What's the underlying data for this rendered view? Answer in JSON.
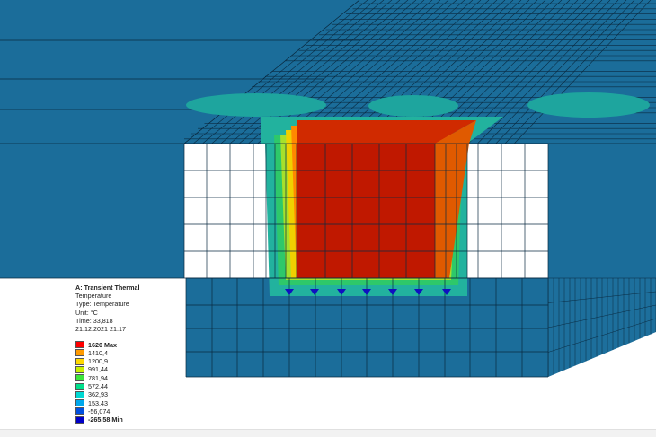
{
  "legend": {
    "title": "A: Transient Thermal",
    "lines": [
      "Temperature",
      "Type: Temperature",
      "Unit: °C",
      "Time: 33,818",
      "21.12.2021 21:17"
    ],
    "levels": [
      {
        "label": "1620 Max",
        "color": "#ff0000",
        "bold": true
      },
      {
        "label": "1410,4",
        "color": "#ff9a00",
        "bold": false
      },
      {
        "label": "1200,9",
        "color": "#ffd800",
        "bold": false
      },
      {
        "label": "991,44",
        "color": "#c8f000",
        "bold": false
      },
      {
        "label": "781,94",
        "color": "#3ce63c",
        "bold": false
      },
      {
        "label": "572,44",
        "color": "#00e08c",
        "bold": false
      },
      {
        "label": "362,93",
        "color": "#00d8d2",
        "bold": false
      },
      {
        "label": "153,43",
        "color": "#00a8ec",
        "bold": false
      },
      {
        "label": "-56,074",
        "color": "#0050e0",
        "bold": false
      },
      {
        "label": "-265,58 Min",
        "color": "#0000c8",
        "bold": true
      }
    ]
  },
  "colors": {
    "background": "#ffffff",
    "steel_blue": "#1b6d9a",
    "steel_blue_dark": "#155a80",
    "hot_core": "#c01800",
    "mesh_line": "#0a2a40"
  }
}
